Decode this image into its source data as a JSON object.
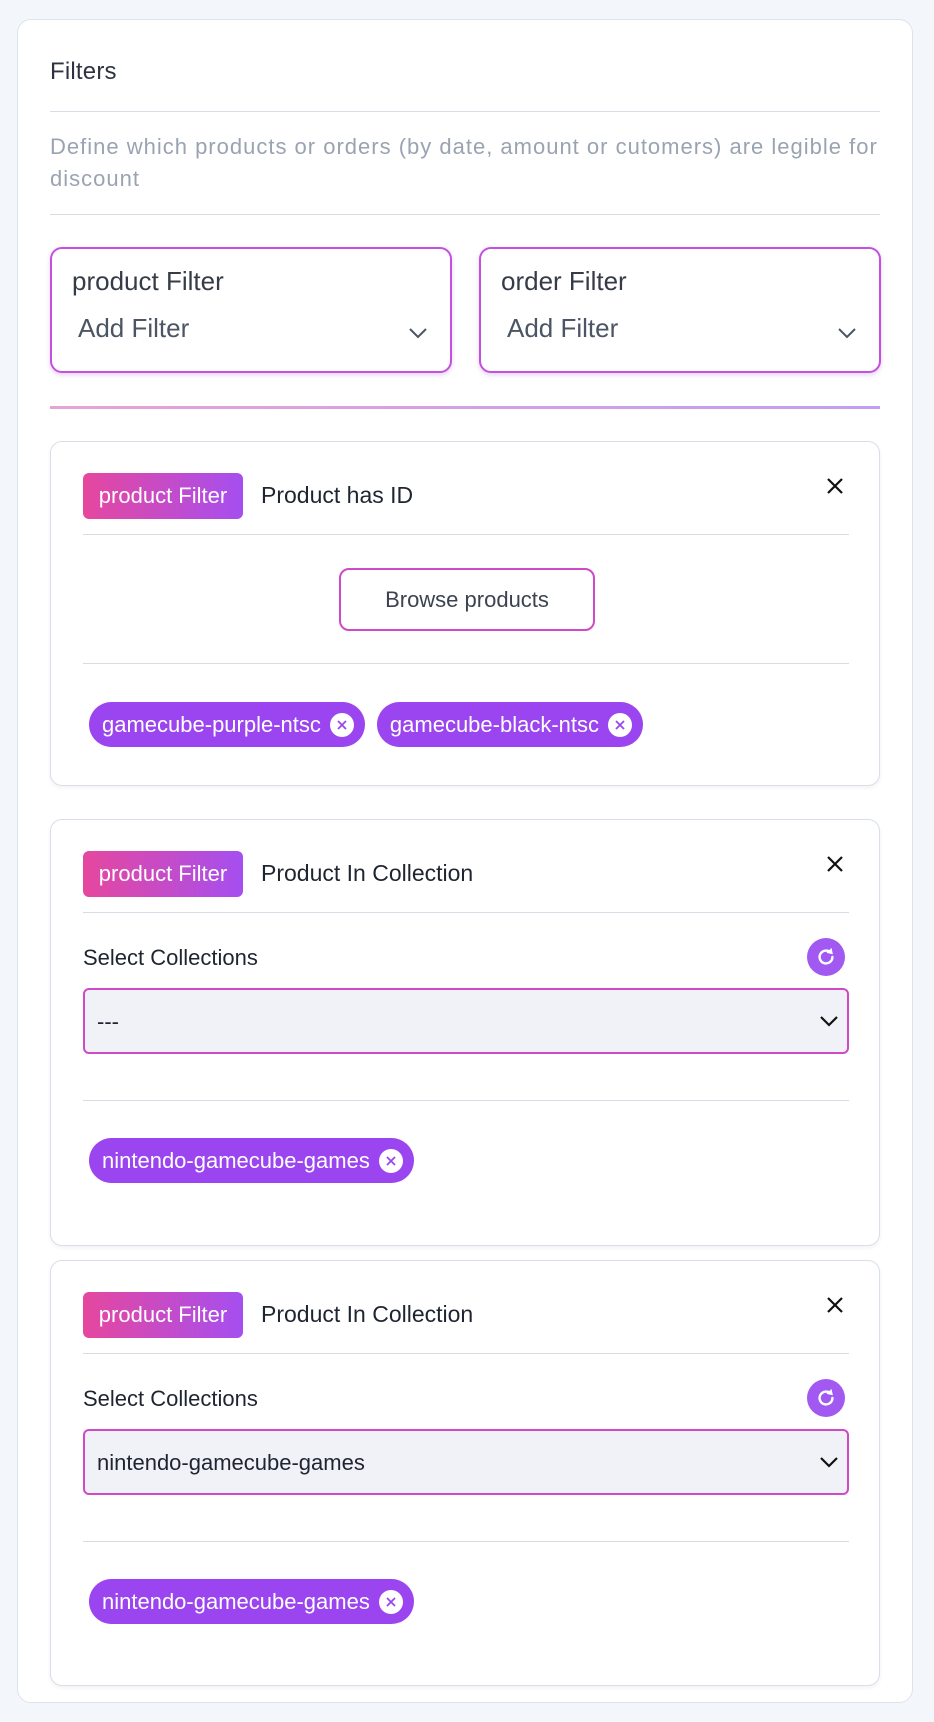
{
  "panel": {
    "title": "Filters",
    "description": "Define which products or orders (by date, amount or cutomers) are legible for discount"
  },
  "filter_selectors": [
    {
      "label": "product Filter",
      "placeholder": "Add Filter"
    },
    {
      "label": "order Filter",
      "placeholder": "Add Filter"
    }
  ],
  "cards": [
    {
      "badge": "product Filter",
      "title": "Product has ID",
      "button_label": "Browse products",
      "chips": [
        "gamecube-purple-ntsc",
        "gamecube-black-ntsc"
      ]
    },
    {
      "badge": "product Filter",
      "title": "Product In Collection",
      "select_label": "Select Collections",
      "select_value": "---",
      "chips": [
        "nintendo-gamecube-games"
      ]
    },
    {
      "badge": "product Filter",
      "title": "Product In Collection",
      "select_label": "Select Collections",
      "select_value": "nintendo-gamecube-games",
      "chips": [
        "nintendo-gamecube-games"
      ]
    }
  ],
  "colors": {
    "accent_purple": "#9b45f0",
    "accent_pink": "#e6479e",
    "border_accent": "#cf4ac6"
  },
  "icons": {
    "select_chevron": "chevron-down-icon",
    "card_close": "close-icon",
    "chip_remove": "remove-chip-icon",
    "refresh": "refresh-icon"
  }
}
